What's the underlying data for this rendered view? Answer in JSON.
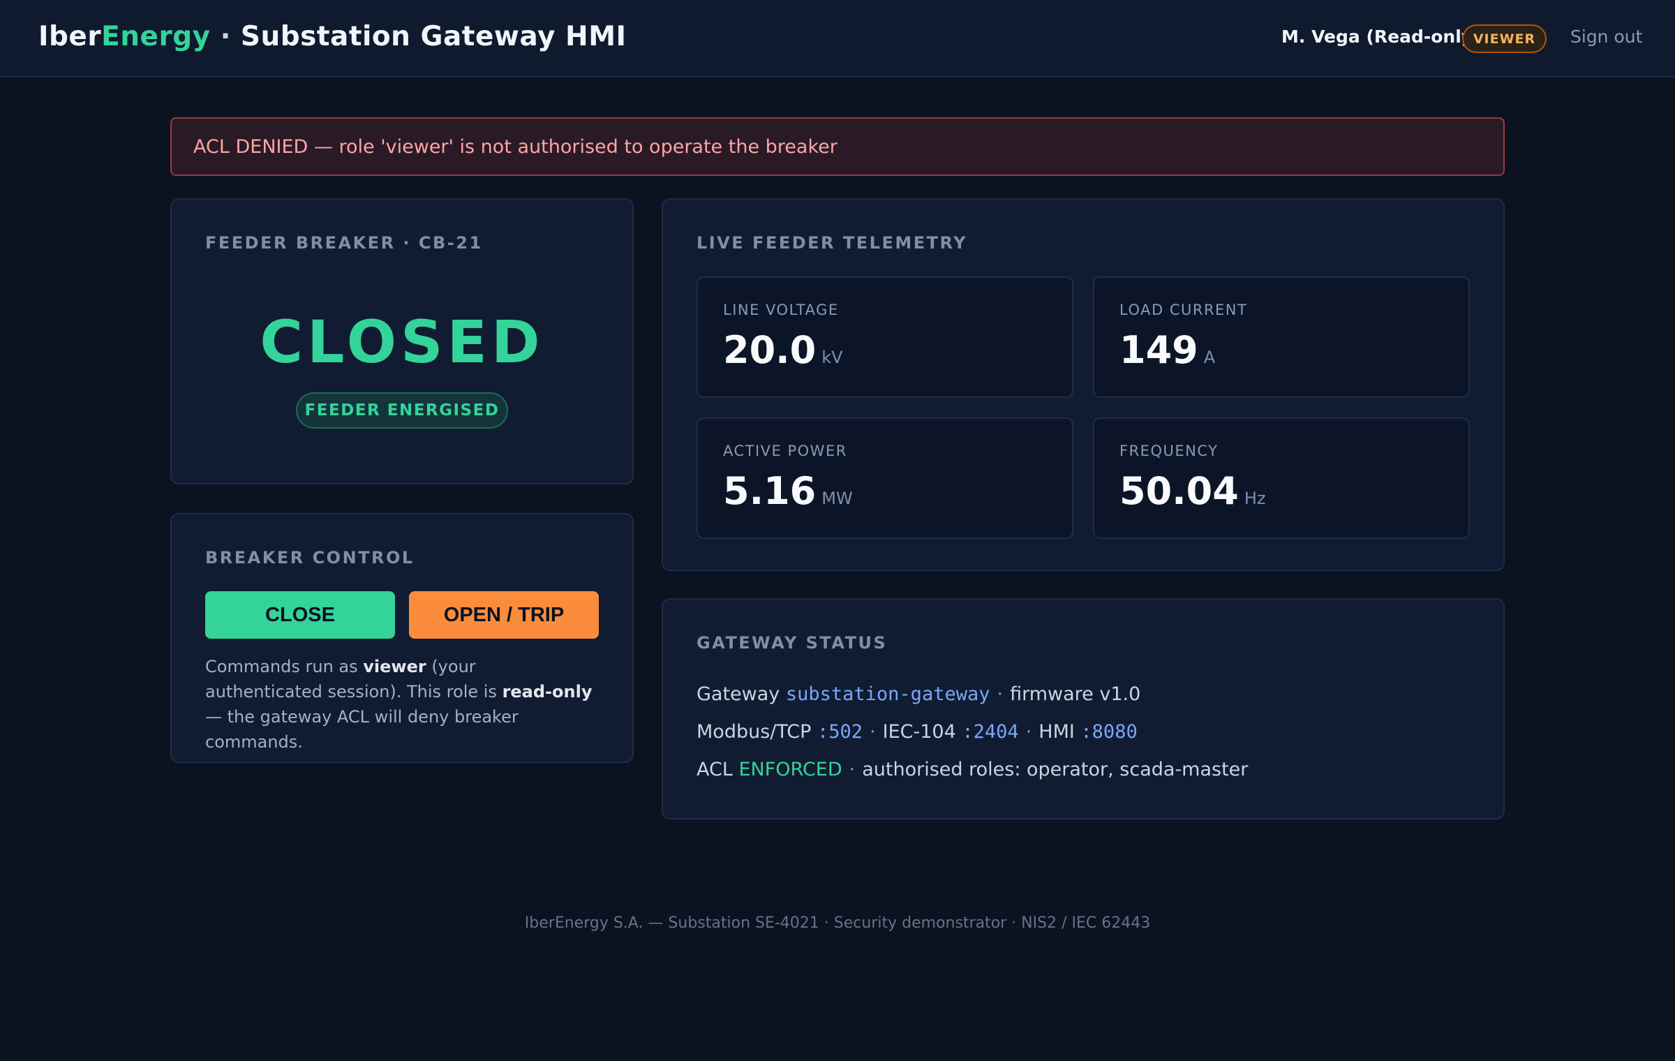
{
  "header": {
    "brand_part1": "Iber",
    "brand_part2": "Energy",
    "separator": "·",
    "title": "Substation Gateway HMI",
    "user": "M. Vega (Read-only)",
    "role_badge": "VIEWER",
    "sign_out": "Sign out"
  },
  "alert": {
    "message": "ACL DENIED — role 'viewer' is not authorised to operate the breaker"
  },
  "breaker": {
    "title": "FEEDER BREAKER · CB-21",
    "state": "CLOSED",
    "badge": "FEEDER ENERGISED"
  },
  "control": {
    "title": "BREAKER CONTROL",
    "close_label": "CLOSE",
    "open_label": "OPEN / TRIP",
    "note_1": "Commands run as ",
    "note_role": "viewer",
    "note_2": " (your authenticated session). This role is ",
    "note_ro": "read-only",
    "note_3": " — the gateway ACL will deny breaker commands."
  },
  "telemetry": {
    "title": "LIVE FEEDER TELEMETRY",
    "metrics": [
      {
        "label": "LINE VOLTAGE",
        "value": "20.0",
        "unit": "kV"
      },
      {
        "label": "LOAD CURRENT",
        "value": "149",
        "unit": "A"
      },
      {
        "label": "ACTIVE POWER",
        "value": "5.16",
        "unit": "MW"
      },
      {
        "label": "FREQUENCY",
        "value": "50.04",
        "unit": "Hz"
      }
    ]
  },
  "gateway": {
    "title": "GATEWAY STATUS",
    "gw_label": "Gateway",
    "gw_name": "substation-gateway",
    "sep": "·",
    "firmware": "firmware v1.0",
    "modbus_label": "Modbus/TCP",
    "modbus_port": ":502",
    "iec_label": "IEC-104",
    "iec_port": ":2404",
    "hmi_label": "HMI",
    "hmi_port": ":8080",
    "acl_label": "ACL",
    "acl_state": "ENFORCED",
    "roles": "authorised roles: operator, scada-master"
  },
  "footer": {
    "text": "IberEnergy S.A. — Substation SE-4021 · Security demonstrator · NIS2 / IEC 62443"
  },
  "colors": {
    "background": "#0b1220",
    "accent_green": "#34d399",
    "accent_orange": "#fb8c3c",
    "alert_red": "#fca5a5",
    "link_blue": "#7aa7f5"
  }
}
